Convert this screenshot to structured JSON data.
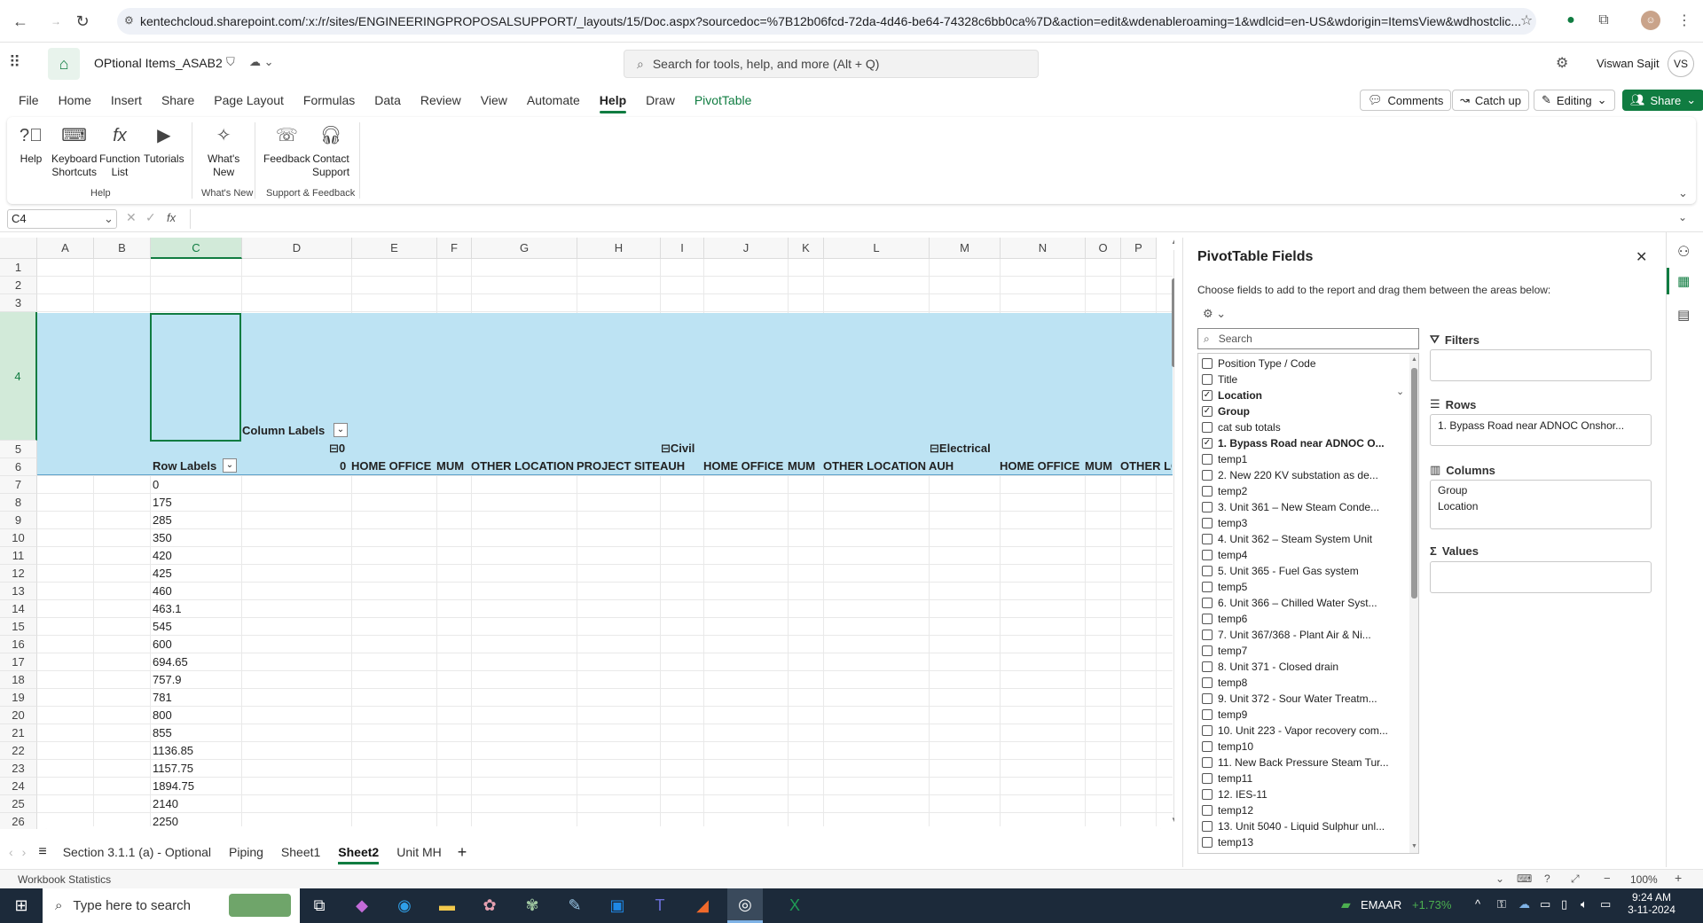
{
  "browser": {
    "url": "kentechcloud.sharepoint.com/:x:/r/sites/ENGINEERINGPROPOSALSUPPORT/_layouts/15/Doc.aspx?sourcedoc=%7B12b06fcd-72da-4d46-be64-74328c6bb0ca%7D&action=edit&wdenableroaming=1&wdlcid=en-US&wdorigin=ItemsView&wdhostclic..."
  },
  "app": {
    "doc_title": "OPtional Items_ASAB2",
    "search_placeholder": "Search for tools, help, and more (Alt + Q)",
    "user_name": "Viswan Sajit",
    "user_initials": "VS"
  },
  "tabs": [
    "File",
    "Home",
    "Insert",
    "Share",
    "Page Layout",
    "Formulas",
    "Data",
    "Review",
    "View",
    "Automate",
    "Help",
    "Draw",
    "PivotTable"
  ],
  "header_buttons": {
    "comments": "Comments",
    "catchup": "Catch up",
    "editing": "Editing",
    "share": "Share"
  },
  "ribbon": {
    "buttons": [
      {
        "l1": "Help",
        "l2": ""
      },
      {
        "l1": "Keyboard",
        "l2": "Shortcuts"
      },
      {
        "l1": "Function",
        "l2": "List"
      },
      {
        "l1": "Tutorials",
        "l2": ""
      },
      {
        "l1": "What's",
        "l2": "New"
      },
      {
        "l1": "Feedback",
        "l2": ""
      },
      {
        "l1": "Contact",
        "l2": "Support"
      }
    ],
    "groups": [
      "Help",
      "What's New",
      "Support & Feedback"
    ]
  },
  "formula": {
    "namebox": "C4",
    "fx": "fx"
  },
  "grid": {
    "columns": [
      "A",
      "B",
      "C",
      "D",
      "E",
      "F",
      "G",
      "H",
      "I",
      "J",
      "K",
      "L",
      "M",
      "N",
      "O",
      "P"
    ],
    "rows": [
      "1",
      "2",
      "3",
      "4",
      "5",
      "6",
      "7",
      "8",
      "9",
      "10",
      "11",
      "12",
      "13",
      "14",
      "15",
      "16",
      "17",
      "18",
      "19",
      "20",
      "21",
      "22",
      "23",
      "24",
      "25",
      "26"
    ],
    "column_labels": "Column Labels",
    "row_labels": "Row Labels",
    "r5": {
      "d": "0",
      "i": "Civil",
      "m": "Electrical"
    },
    "r6": [
      "0",
      "HOME OFFICE",
      "MUM",
      "OTHER LOCATION",
      "PROJECT SITE",
      "AUH",
      "HOME OFFICE",
      "MUM",
      "OTHER LOCATION",
      "AUH",
      "HOME OFFICE",
      "MUM",
      "OTHER LO"
    ],
    "values": [
      "0",
      "175",
      "285",
      "350",
      "420",
      "425",
      "460",
      "463.1",
      "545",
      "600",
      "694.65",
      "757.9",
      "781",
      "800",
      "855",
      "1136.85",
      "1157.75",
      "1894.75",
      "2140",
      "2250"
    ]
  },
  "sheets": [
    "Section 3.1.1 (a) - Optional",
    "Piping",
    "Sheet1",
    "Sheet2",
    "Unit MH"
  ],
  "status": {
    "left": "Workbook Statistics",
    "zoom": "100%"
  },
  "pivot": {
    "title": "PivotTable Fields",
    "subtitle": "Choose fields to add to the report and drag them between the areas below:",
    "search_placeholder": "Search",
    "fields": [
      {
        "label": "Position Type / Code",
        "checked": false,
        "bold": false
      },
      {
        "label": "Title",
        "checked": false,
        "bold": false
      },
      {
        "label": "Location",
        "checked": true,
        "bold": true
      },
      {
        "label": "Group",
        "checked": true,
        "bold": true
      },
      {
        "label": "cat sub totals",
        "checked": false,
        "bold": false
      },
      {
        "label": "1.     Bypass Road near ADNOC O...",
        "checked": true,
        "bold": true
      },
      {
        "label": "temp1",
        "checked": false,
        "bold": false
      },
      {
        "label": "2.     New 220 KV substation as de...",
        "checked": false,
        "bold": false
      },
      {
        "label": "temp2",
        "checked": false,
        "bold": false
      },
      {
        "label": "3.     Unit 361 – New Steam Conde...",
        "checked": false,
        "bold": false
      },
      {
        "label": "temp3",
        "checked": false,
        "bold": false
      },
      {
        "label": "4.     Unit 362 – Steam System Unit",
        "checked": false,
        "bold": false
      },
      {
        "label": "temp4",
        "checked": false,
        "bold": false
      },
      {
        "label": "5.     Unit 365 - Fuel Gas system",
        "checked": false,
        "bold": false
      },
      {
        "label": "temp5",
        "checked": false,
        "bold": false
      },
      {
        "label": "6.     Unit 366 – Chilled Water Syst...",
        "checked": false,
        "bold": false
      },
      {
        "label": "temp6",
        "checked": false,
        "bold": false
      },
      {
        "label": "7.     Unit 367/368 - Plant Air & Ni...",
        "checked": false,
        "bold": false
      },
      {
        "label": "temp7",
        "checked": false,
        "bold": false
      },
      {
        "label": "8.     Unit 371 - Closed drain",
        "checked": false,
        "bold": false
      },
      {
        "label": "temp8",
        "checked": false,
        "bold": false
      },
      {
        "label": "9.     Unit 372 - Sour Water Treatm...",
        "checked": false,
        "bold": false
      },
      {
        "label": "temp9",
        "checked": false,
        "bold": false
      },
      {
        "label": "10.   Unit 223 - Vapor recovery com...",
        "checked": false,
        "bold": false
      },
      {
        "label": "temp10",
        "checked": false,
        "bold": false
      },
      {
        "label": "11.   New Back Pressure Steam Tur...",
        "checked": false,
        "bold": false
      },
      {
        "label": "temp11",
        "checked": false,
        "bold": false
      },
      {
        "label": "12.   IES-11",
        "checked": false,
        "bold": false
      },
      {
        "label": "temp12",
        "checked": false,
        "bold": false
      },
      {
        "label": "13.   Unit 5040 - Liquid Sulphur unl...",
        "checked": false,
        "bold": false
      },
      {
        "label": "temp13",
        "checked": false,
        "bold": false
      }
    ],
    "areas": {
      "filters": {
        "label": "Filters",
        "items": []
      },
      "rows": {
        "label": "Rows",
        "items": [
          "1.     Bypass Road near ADNOC Onshor..."
        ]
      },
      "columns": {
        "label": "Columns",
        "items": [
          "Group",
          "Location"
        ]
      },
      "values": {
        "label": "Values",
        "items": []
      }
    }
  },
  "taskbar": {
    "search_placeholder": "Type here to search",
    "stock_name": "EMAAR",
    "stock_change": "+1.73%",
    "time": "9:24 AM",
    "date": "3-11-2024"
  }
}
